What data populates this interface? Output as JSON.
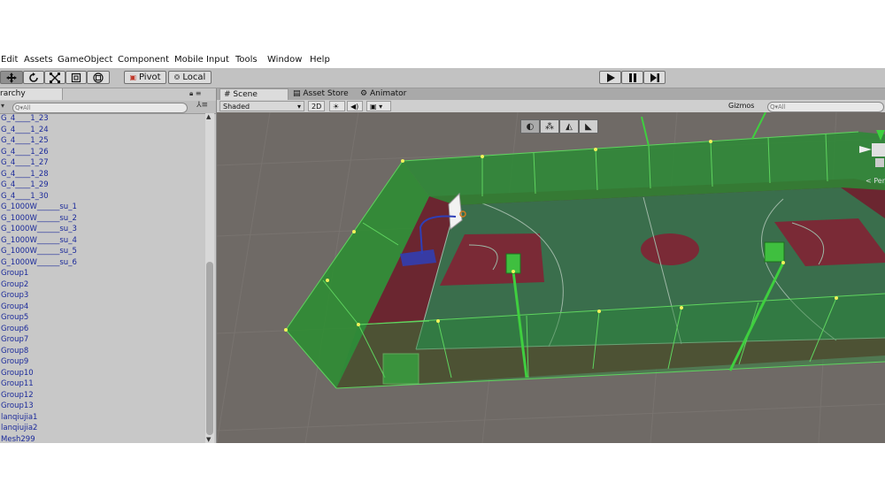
{
  "menu": [
    "Edit",
    "Assets",
    "GameObject",
    "Component",
    "Mobile Input",
    "Tools",
    "Window",
    "Help"
  ],
  "toolbar": {
    "tools": [
      "hand-tool-icon",
      "move-tool-icon",
      "rotate-tool-icon",
      "scale-tool-icon",
      "rect-tool-icon"
    ],
    "pivot_label": "Pivot",
    "local_label": "Local",
    "play_icons": [
      "play-icon",
      "pause-icon",
      "step-icon"
    ]
  },
  "hierarchy": {
    "tab_label": "rarchy",
    "search_placeholder": "Q▾All",
    "items": [
      "G_4____1_23",
      "G_4____1_24",
      "G_4____1_25",
      "G_4____1_26",
      "G_4____1_27",
      "G_4____1_28",
      "G_4____1_29",
      "G_4____1_30",
      "G_1000W______su_1",
      "G_1000W______su_2",
      "G_1000W______su_3",
      "G_1000W______su_4",
      "G_1000W______su_5",
      "G_1000W______su_6",
      "Group1",
      "Group2",
      "Group3",
      "Group4",
      "Group5",
      "Group6",
      "Group7",
      "Group8",
      "Group9",
      "Group10",
      "Group11",
      "Group12",
      "Group13",
      "lanqiujia1",
      "lanqiujia2",
      "Mesh299"
    ]
  },
  "scene": {
    "tabs": [
      "Scene",
      "Asset Store",
      "Animator"
    ],
    "shading_mode": "Shaded",
    "mode_2d": "2D",
    "gizmos_label": "Gizmos",
    "search_placeholder": "Q▾All",
    "persp_label": "< Per"
  },
  "colors": {
    "court_green": "#3a6e4c",
    "court_red": "#7a2a36",
    "fence_green": "#2f9a2f",
    "ground": "#6f6a66"
  }
}
